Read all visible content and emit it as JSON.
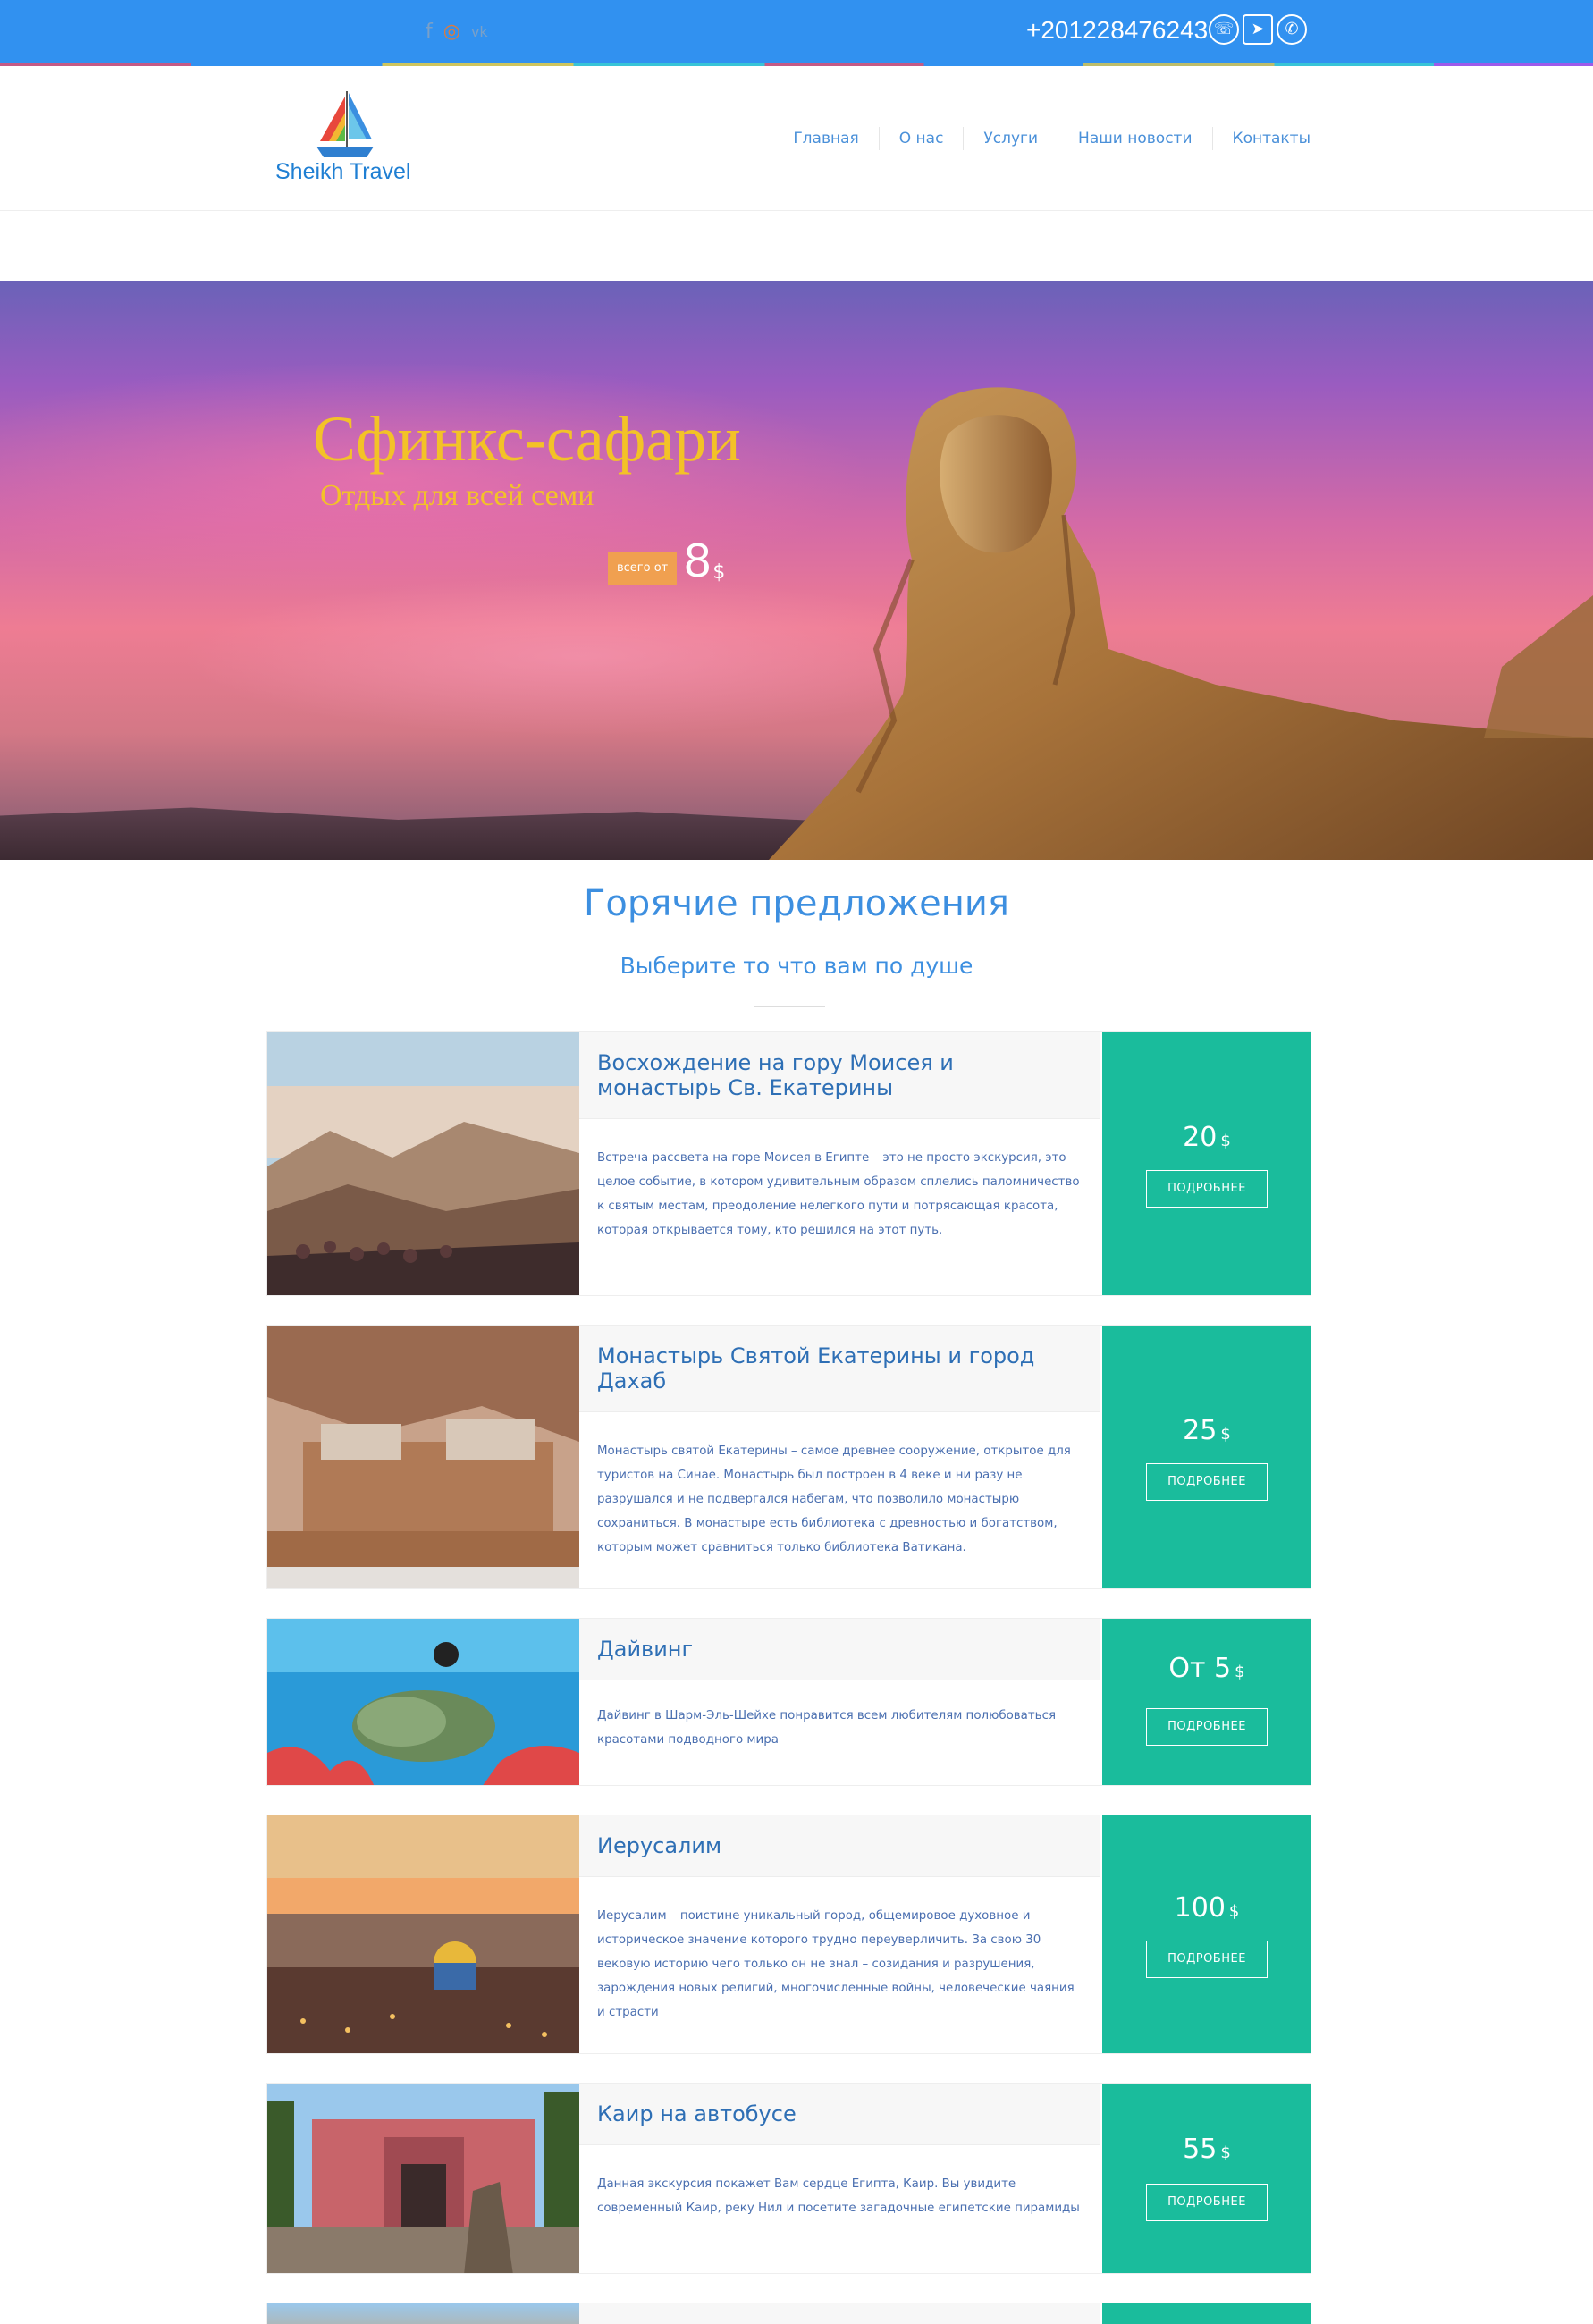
{
  "topbar": {
    "phone": "+201228476243",
    "social_icons": [
      "facebook-icon",
      "instagram-icon",
      "vk-icon"
    ],
    "messenger_icons": [
      "viber-icon",
      "telegram-icon",
      "whatsapp-icon"
    ],
    "social_glyphs": {
      "facebook": "f",
      "instagram": "◎",
      "vk": "vk"
    },
    "messenger_glyphs": {
      "viber": "☏",
      "telegram": "➤",
      "whatsapp": "✆"
    }
  },
  "header": {
    "logo_text": "Sheikh Travel",
    "nav": [
      "Главная",
      "О нас",
      "Услуги",
      "Наши новости",
      "Контакты"
    ]
  },
  "hero": {
    "title": "Сфинкс-сафари",
    "subtitle": "Отдых для всей семи",
    "badge": "всего от",
    "price": "8",
    "currency": "$"
  },
  "section": {
    "title": "Горячие предложения",
    "subtitle": "Выберите то что вам по душе"
  },
  "offers": [
    {
      "title": "Восхождение на гору Моисея и монастырь Св. Екатерины",
      "text": "Встреча рассвета на горе Моисея в Египте – это не просто экскурсия, это целое событие, в котором удивительным образом сплелись паломничество к святым местам, преодоление нелегкого пути и потрясающая красота, которая открывается тому, кто решился на этот путь.",
      "price": "20",
      "currency": "$",
      "button": "ПОДРОБНЕЕ"
    },
    {
      "title": "Монастырь Святой Екатерины и город Дахаб",
      "text": "Монастырь святой Екатерины – самое древнее сооружение, открытое для туристов на Синае. Монастырь был построен в 4 веке и ни разу не разрушался и не подвергался набегам, что позволило монастырю сохраниться. В монастыре есть библиотека с древностью и богатством, которым может сравниться только библиотека Ватикана.",
      "price": "25",
      "currency": "$",
      "button": "ПОДРОБНЕЕ"
    },
    {
      "title": "Дайвинг",
      "text": "Дайвинг в Шарм-Эль-Шейхе понравится всем любителям полюбоваться красотами подводного мира",
      "price": "От 5",
      "currency": "$",
      "button": "ПОДРОБНЕЕ"
    },
    {
      "title": "Иерусалим",
      "text": "Иерусалим – поистине уникальный город, общемировое духовное и историческое значение которого трудно переуверличить. За свою 30 вековую историю чего только он не знал – созидания и разрушения, зарождения новых религий, многочисленные войны, человеческие чаяния и страсти",
      "price": "100",
      "currency": "$",
      "button": "ПОДРОБНЕЕ"
    },
    {
      "title": "Каир на автобусе",
      "text": "Данная экскурсия покажет Вам сердце Египта, Каир. Вы увидите современный Каир, реку Нил и посетите загадочные египетские пирамиды",
      "price": "55",
      "currency": "$",
      "button": "ПОДРОБНЕЕ"
    }
  ],
  "colors": {
    "topbar": "#3191f0",
    "accent": "#1abc9c",
    "link": "#3d8fe0",
    "hero_title": "#f3c227",
    "badge": "#f0a050"
  }
}
